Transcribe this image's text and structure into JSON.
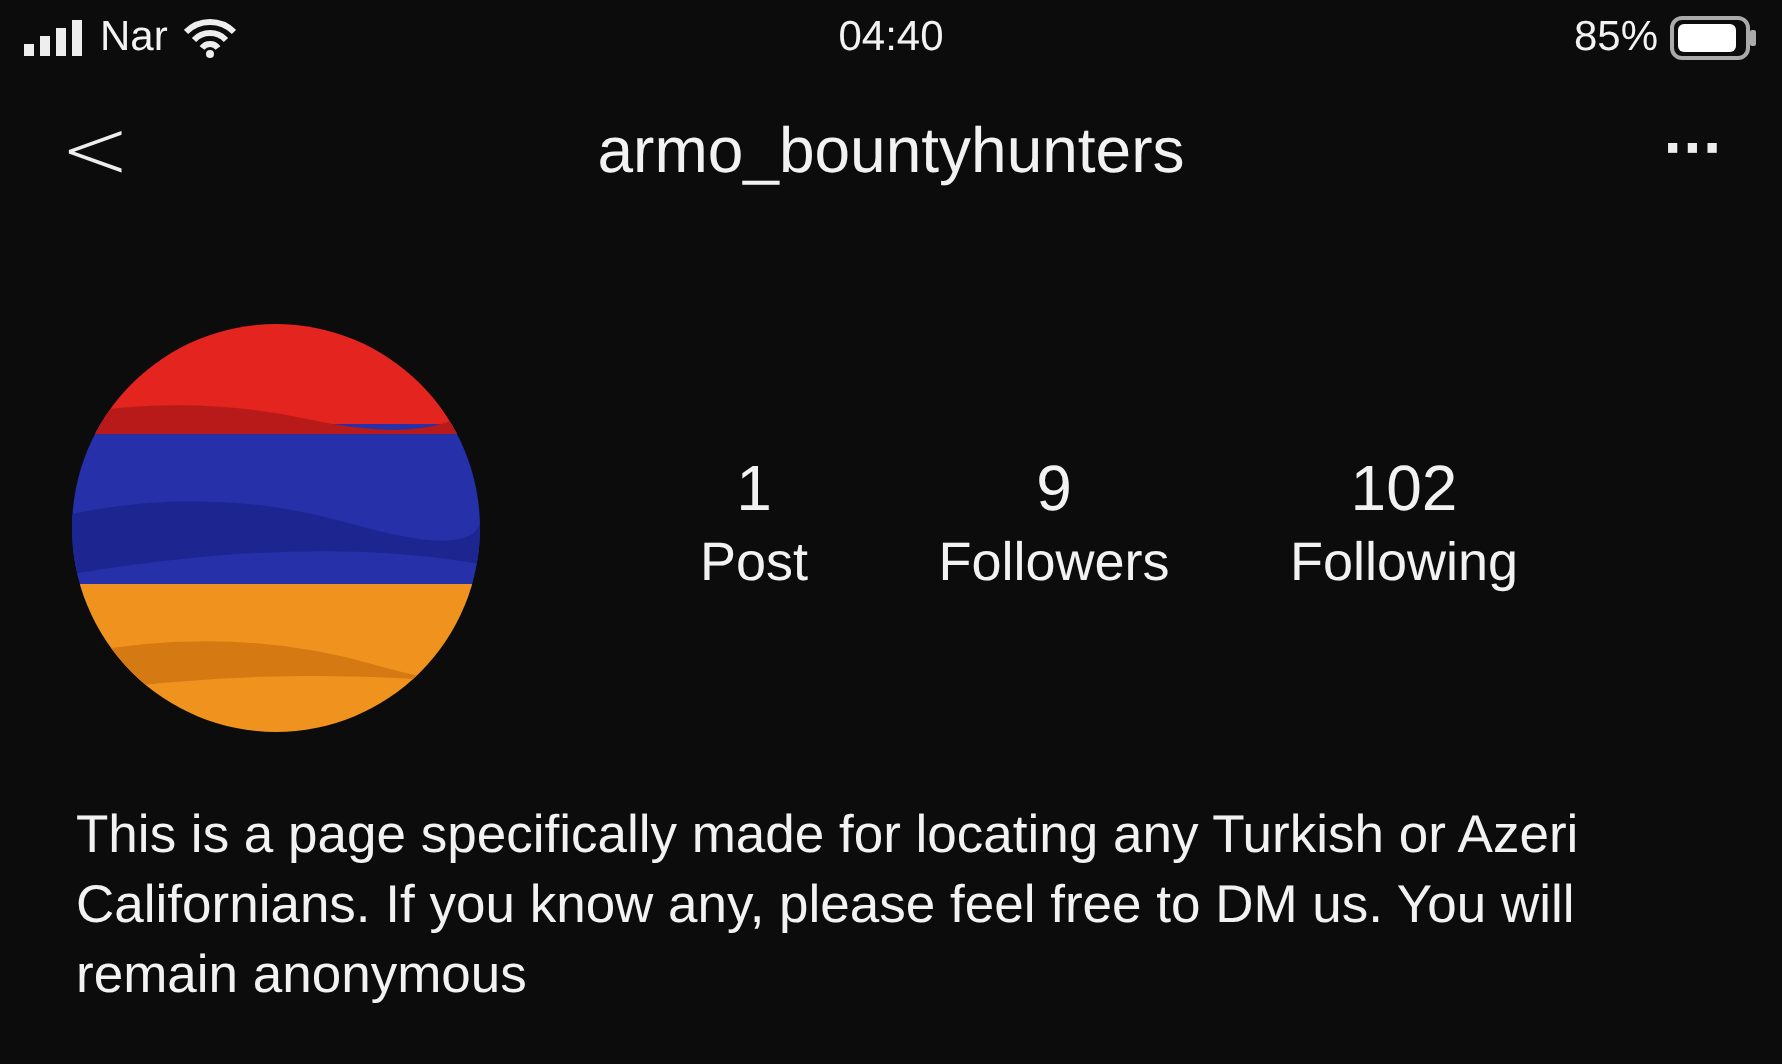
{
  "status_bar": {
    "carrier": "Nar",
    "time": "04:40",
    "battery": "85%"
  },
  "header": {
    "back": "<",
    "username": "armo_bountyhunters",
    "more": "···"
  },
  "stats": [
    {
      "count": "1",
      "label": "Post"
    },
    {
      "count": "9",
      "label": "Followers"
    },
    {
      "count": "102",
      "label": "Following"
    }
  ],
  "bio": "This is a page specifically made for locating any Turkish or Azeri Californians. If you know any, please feel free to DM us. You will remain anonymous"
}
